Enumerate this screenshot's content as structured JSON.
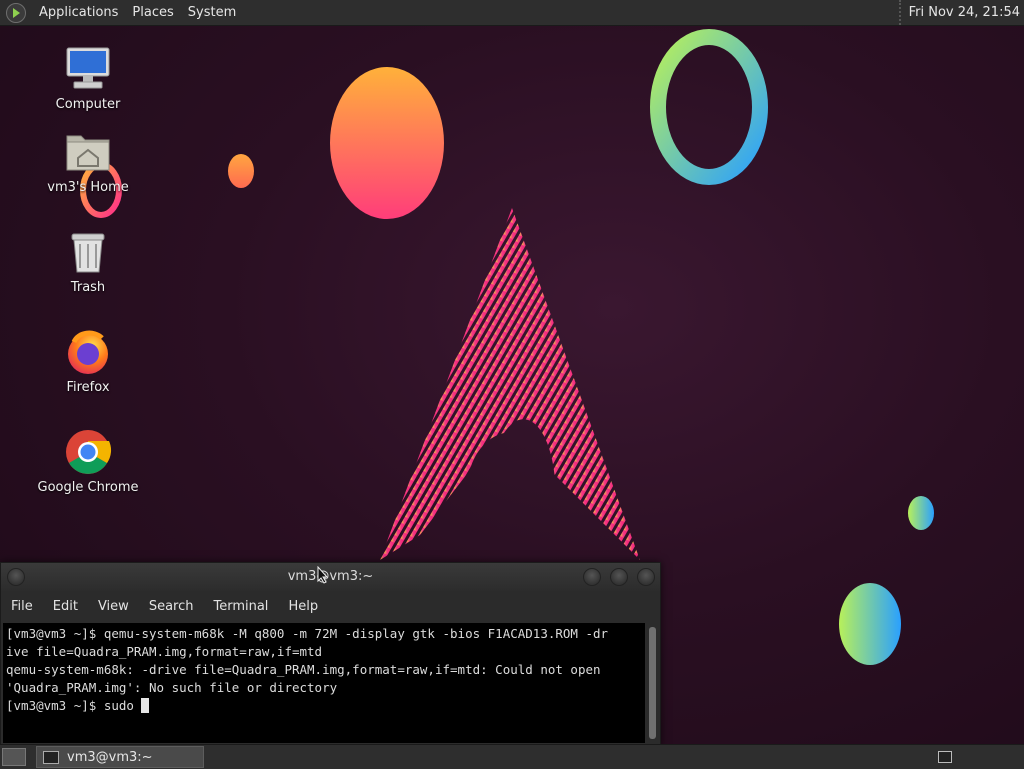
{
  "top_panel": {
    "menus": [
      "Applications",
      "Places",
      "System"
    ],
    "clock": "Fri Nov 24, 21:54"
  },
  "desktop": {
    "icons": [
      {
        "label": "Computer",
        "icon": "computer-icon"
      },
      {
        "label": "vm3's Home",
        "icon": "home-folder-icon"
      },
      {
        "label": "Trash",
        "icon": "trash-icon"
      },
      {
        "label": "Firefox",
        "icon": "firefox-icon"
      },
      {
        "label": "Google Chrome",
        "icon": "chrome-icon"
      }
    ]
  },
  "terminal": {
    "title": "vm3@vm3:~",
    "menu": [
      "File",
      "Edit",
      "View",
      "Search",
      "Terminal",
      "Help"
    ],
    "lines": [
      "[vm3@vm3 ~]$ qemu-system-m68k -M q800 -m 72M -display gtk -bios F1ACAD13.ROM -dr",
      "ive file=Quadra_PRAM.img,format=raw,if=mtd",
      "qemu-system-m68k: -drive file=Quadra_PRAM.img,format=raw,if=mtd: Could not open",
      "'Quadra_PRAM.img': No such file or directory"
    ],
    "prompt": "[vm3@vm3 ~]$ sudo "
  },
  "taskbar": {
    "tasks": [
      {
        "label": "vm3@vm3:~",
        "icon": "terminal-icon"
      }
    ]
  },
  "colors": {
    "background": "#2a0f22",
    "panel": "#2e2e2e",
    "accent_pink": "#ff2d8a",
    "accent_orange": "#ff9a2e"
  }
}
